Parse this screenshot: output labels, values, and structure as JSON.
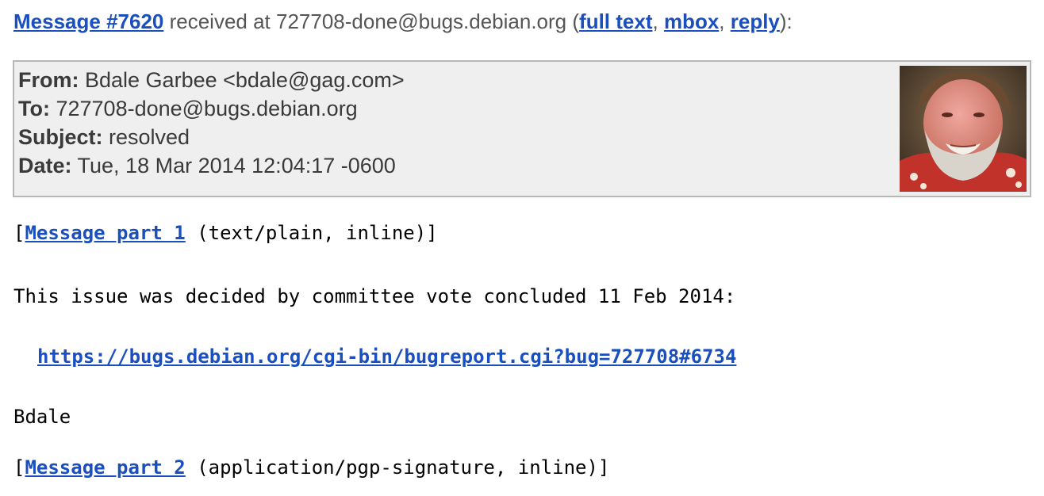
{
  "message_line": {
    "link": "Message #7620",
    "text1": " received at 727708-done@bugs.debian.org (",
    "full_text": "full text",
    "sep1": ", ",
    "mbox": "mbox",
    "sep2": ", ",
    "reply": "reply",
    "text2": "):"
  },
  "headers": {
    "from_label": "From:",
    "from_value": " Bdale Garbee <bdale@gag.com>",
    "to_label": "To:",
    "to_value": " 727708-done@bugs.debian.org",
    "subject_label": "Subject:",
    "subject_value": " resolved",
    "date_label": "Date:",
    "date_value": " Tue, 18 Mar 2014 12:04:17 -0600"
  },
  "part1": {
    "open": "[",
    "link": "Message part 1",
    "rest": " (text/plain, inline)]"
  },
  "body": {
    "line1": "This issue was decided by committee vote concluded 11 Feb 2014:",
    "url": "https://bugs.debian.org/cgi-bin/bugreport.cgi?bug=727708#6734",
    "signature": "Bdale"
  },
  "part2": {
    "open": "[",
    "link": "Message part 2",
    "rest": " (application/pgp-signature, inline)]"
  }
}
